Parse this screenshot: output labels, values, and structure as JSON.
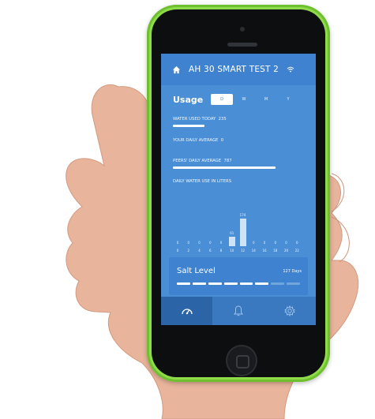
{
  "header": {
    "device_name": "AH 30 SMART TEST 2",
    "home_icon": "home-icon",
    "wifi_icon": "wifi-icon"
  },
  "usage": {
    "title": "Usage",
    "periods": [
      "D",
      "W",
      "M",
      "Y"
    ],
    "selected_period": "D"
  },
  "metrics": {
    "water_used_today_label": "WATER USED TODAY",
    "water_used_today_value": "235",
    "your_daily_avg_label": "YOUR DAILY AVERAGE",
    "your_daily_avg_value": "0",
    "peers_daily_avg_label": "PEERS' DAILY AVERAGE",
    "peers_daily_avg_value": "787",
    "chart_label": "DAILY WATER USE IN LITERS"
  },
  "chart_data": {
    "type": "bar",
    "categories": [
      "0",
      "2",
      "4",
      "6",
      "8",
      "10",
      "12",
      "14",
      "16",
      "18",
      "20",
      "22"
    ],
    "values": [
      0,
      0,
      0,
      0,
      0,
      61,
      174,
      0,
      0,
      0,
      0,
      0
    ],
    "title": "DAILY WATER USE IN LITERS",
    "ylim": [
      0,
      200
    ]
  },
  "salt": {
    "label": "Salt Level",
    "days": "127 Days",
    "level_fraction": 0.8
  },
  "nav": {
    "items": [
      "gauge-icon",
      "bell-icon",
      "settings-icon"
    ],
    "active": 0
  },
  "colors": {
    "screen_bg": "#4a8fd6",
    "topbar_bg": "#3f82cf",
    "phone_case": "#8fdc4a"
  }
}
